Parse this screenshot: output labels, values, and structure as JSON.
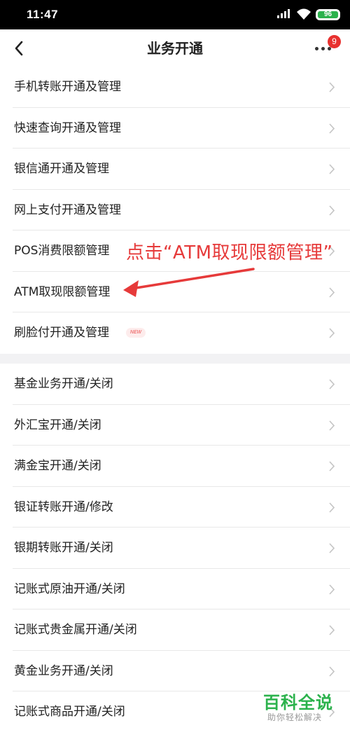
{
  "status_bar": {
    "time": "11:47",
    "battery_level": "96",
    "icons": [
      "signal-icon",
      "wifi-icon",
      "battery-icon"
    ]
  },
  "nav": {
    "back_icon": "chevron-left-icon",
    "title": "业务开通",
    "more_icon": "more-dots-icon",
    "badge_count": "9"
  },
  "section1": {
    "items": [
      {
        "label": "手机转账开通及管理"
      },
      {
        "label": "快速查询开通及管理"
      },
      {
        "label": "银信通开通及管理"
      },
      {
        "label": "网上支付开通及管理"
      },
      {
        "label": "POS消费限额管理"
      },
      {
        "label": "ATM取现限额管理"
      },
      {
        "label": "刷脸付开通及管理",
        "badge": "NEW"
      }
    ]
  },
  "section2": {
    "items": [
      {
        "label": "基金业务开通/关闭"
      },
      {
        "label": "外汇宝开通/关闭"
      },
      {
        "label": "满金宝开通/关闭"
      },
      {
        "label": "银证转账开通/修改"
      },
      {
        "label": "银期转账开通/关闭"
      },
      {
        "label": "记账式原油开通/关闭"
      },
      {
        "label": "记账式贵金属开通/关闭"
      },
      {
        "label": "黄金业务开通/关闭"
      },
      {
        "label": "记账式商品开通/关闭"
      }
    ]
  },
  "annotation": {
    "text": "点击“ATM取现限额管理”",
    "color": "#e63a3a"
  },
  "watermark": {
    "title": "百科全说",
    "subtitle": "助你轻松解决"
  },
  "colors": {
    "accent_red": "#e8312f",
    "watermark_green": "#2bb24c",
    "divider": "#e8e8e8"
  }
}
